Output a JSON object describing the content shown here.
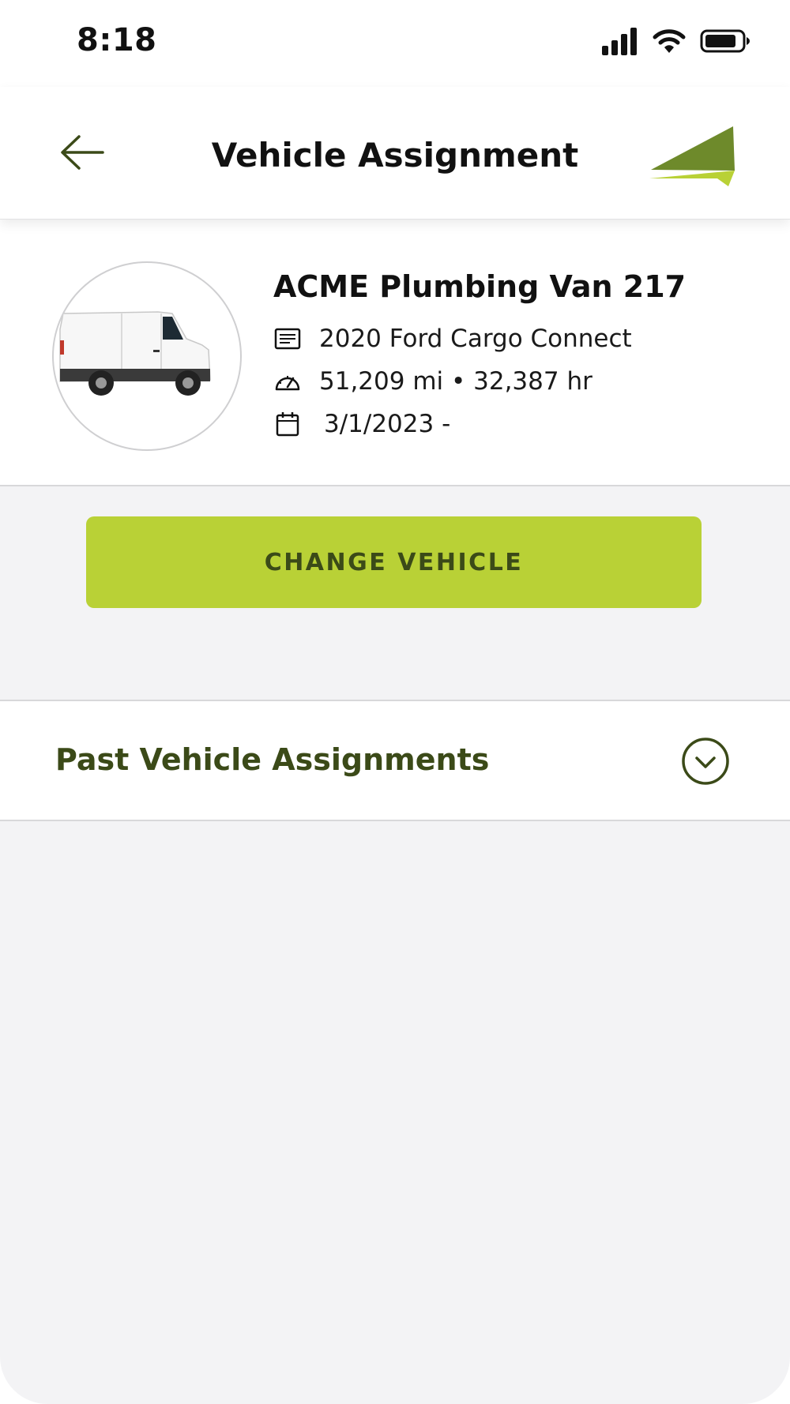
{
  "status_bar": {
    "time": "8:18"
  },
  "header": {
    "title": "Vehicle Assignment",
    "back_icon": "arrow-left-icon",
    "logo": "brand-logo-icon"
  },
  "vehicle": {
    "name": "ACME Plumbing Van 217",
    "model": "2020 Ford Cargo Connect",
    "usage": "51,209 mi • 32,387 hr",
    "assigned_date": "3/1/2023 -",
    "icons": {
      "model": "vehicle-info-card-icon",
      "usage": "odometer-icon",
      "date": "calendar-icon"
    }
  },
  "actions": {
    "change_vehicle": "CHANGE VEHICLE"
  },
  "past_assignments": {
    "label": "Past Vehicle Assignments",
    "toggle_icon": "chevron-down-circle-icon"
  },
  "colors": {
    "accent": "#b9d136",
    "accent_text": "#3b4a18",
    "logo_dark": "#6e8a2b",
    "background": "#f3f3f5"
  }
}
